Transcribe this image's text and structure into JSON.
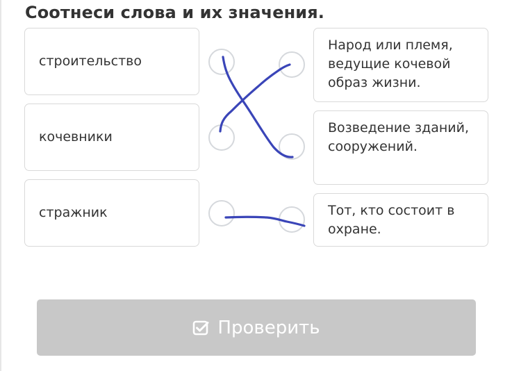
{
  "task": {
    "title": "Соотнеси слова и их значения."
  },
  "words": [
    {
      "label": "строительство"
    },
    {
      "label": "кочевники"
    },
    {
      "label": "стражник"
    }
  ],
  "definitions": [
    {
      "label": "Народ или племя, ведущие кочевой образ жизни."
    },
    {
      "label": "Возведение зданий, сооружений."
    },
    {
      "label": "Тот, кто состоит в охране."
    }
  ],
  "check_button": {
    "label": "Проверить",
    "icon": "checkbox-checked-icon",
    "state": "disabled"
  },
  "colors": {
    "text": "#333333",
    "card_border": "#d9d9d9",
    "dot_border": "#d5d8dc",
    "pen_stroke": "#3a45b8",
    "button_disabled": "#c8c8c8"
  }
}
